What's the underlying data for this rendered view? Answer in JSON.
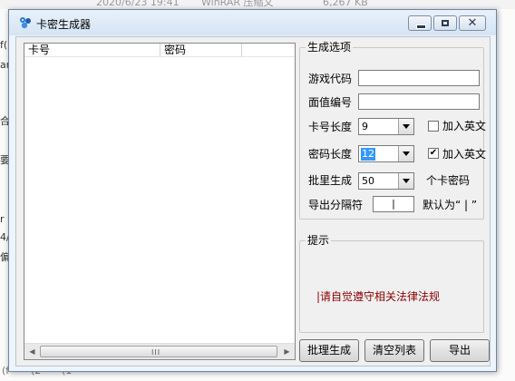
{
  "background": {
    "top_items": [
      "2020/6/23 19:41",
      "WinRAR 压缩文",
      "6,267 KB"
    ],
    "left_fragments": [
      "f(1",
      "ar",
      "合",
      "要",
      "r",
      "4/",
      "偏"
    ],
    "bottom_fragments": [
      "(f",
      "(2",
      "(1"
    ]
  },
  "window": {
    "title": "卡密生成器"
  },
  "list": {
    "columns": [
      "卡号",
      "密码"
    ],
    "scroll_grip": "III"
  },
  "generate": {
    "legend": "生成选项",
    "game_code_label": "游戏代码",
    "game_code_value": "",
    "face_value_label": "面值编号",
    "face_value_value": "",
    "card_len_label": "卡号长度",
    "card_len_value": "9",
    "card_add_english_label": "加入英文",
    "card_add_english_checked": false,
    "pwd_len_label": "密码长度",
    "pwd_len_value": "12",
    "pwd_add_english_label": "加入英文",
    "pwd_add_english_checked": true,
    "batch_label": "批里生成",
    "batch_value": "50",
    "batch_unit": "个卡密码",
    "separator_label": "导出分隔符",
    "separator_value": "|",
    "separator_default": "默认为“ | ”"
  },
  "tip": {
    "legend": "提示",
    "text": "|请自觉遵守相关法律法规"
  },
  "buttons": {
    "batch_generate": "批理生成",
    "clear_list": "清空列表",
    "export": "导出"
  }
}
